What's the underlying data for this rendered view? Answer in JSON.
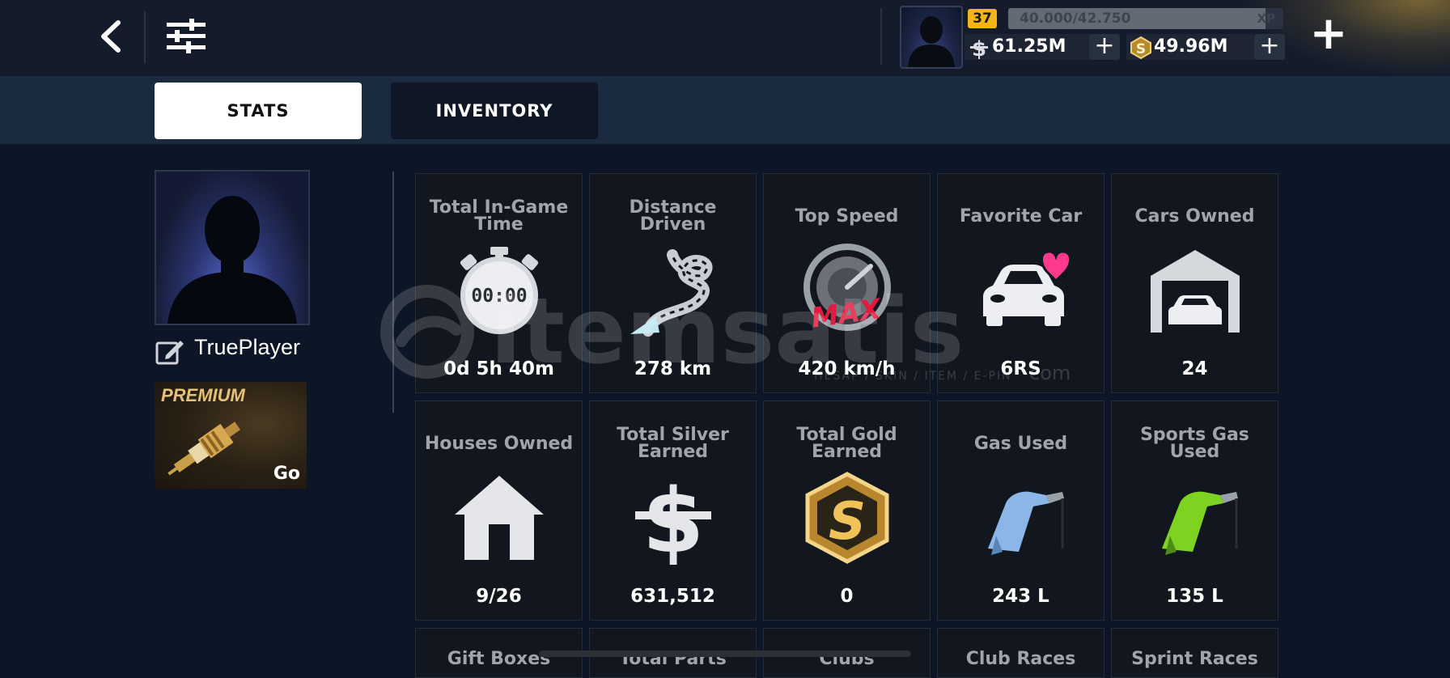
{
  "header": {
    "level": "37",
    "xp_text": "40.000/42.750",
    "xp_label": "XP",
    "xp_progress": 0.936,
    "silver": "61.25M",
    "gold": "49.96M"
  },
  "tabs": [
    {
      "label": "STATS",
      "active": true
    },
    {
      "label": "INVENTORY",
      "active": false
    }
  ],
  "player": {
    "name": "TruePlayer",
    "premium_label": "PREMIUM",
    "premium_go": "Go"
  },
  "stats": [
    {
      "title": "Total In-Game Time",
      "value": "0d 5h 40m",
      "icon": "stopwatch-icon",
      "icon_text": "00:00"
    },
    {
      "title": "Distance Driven",
      "value": "278 km",
      "icon": "road-icon"
    },
    {
      "title": "Top Speed",
      "value": "420 km/h",
      "icon": "speedometer-icon",
      "icon_text": "MAX"
    },
    {
      "title": "Favorite Car",
      "value": "6RS",
      "icon": "car-heart-icon"
    },
    {
      "title": "Cars Owned",
      "value": "24",
      "icon": "garage-icon"
    },
    {
      "title": "Houses Owned",
      "value": "9/26",
      "icon": "house-icon"
    },
    {
      "title": "Total Silver Earned",
      "value": "631,512",
      "icon": "silver-dollar-icon"
    },
    {
      "title": "Total Gold Earned",
      "value": "0",
      "icon": "gold-coin-icon"
    },
    {
      "title": "Gas Used",
      "value": "243 L",
      "icon": "gas-nozzle-icon"
    },
    {
      "title": "Sports Gas Used",
      "value": "135 L",
      "icon": "sports-gas-nozzle-icon"
    },
    {
      "title": "Gift Boxes"
    },
    {
      "title": "Total Parts"
    },
    {
      "title": "Clubs"
    },
    {
      "title": "Club Races"
    },
    {
      "title": "Sprint Races"
    }
  ],
  "watermark": {
    "main": "itemsatis",
    "sub": "HESAP / SKIN / ITEM / E-PIN",
    "dotcom": "com"
  },
  "colors": {
    "background": "#0d1626",
    "topbar": "#141c2b",
    "tabbar": "#1a2b40",
    "card": "#12161e",
    "level_badge": "#f3b519",
    "gold_accent": "#c9a03c",
    "max_red": "#e01b3f",
    "heart_pink": "#ff3a8c"
  }
}
